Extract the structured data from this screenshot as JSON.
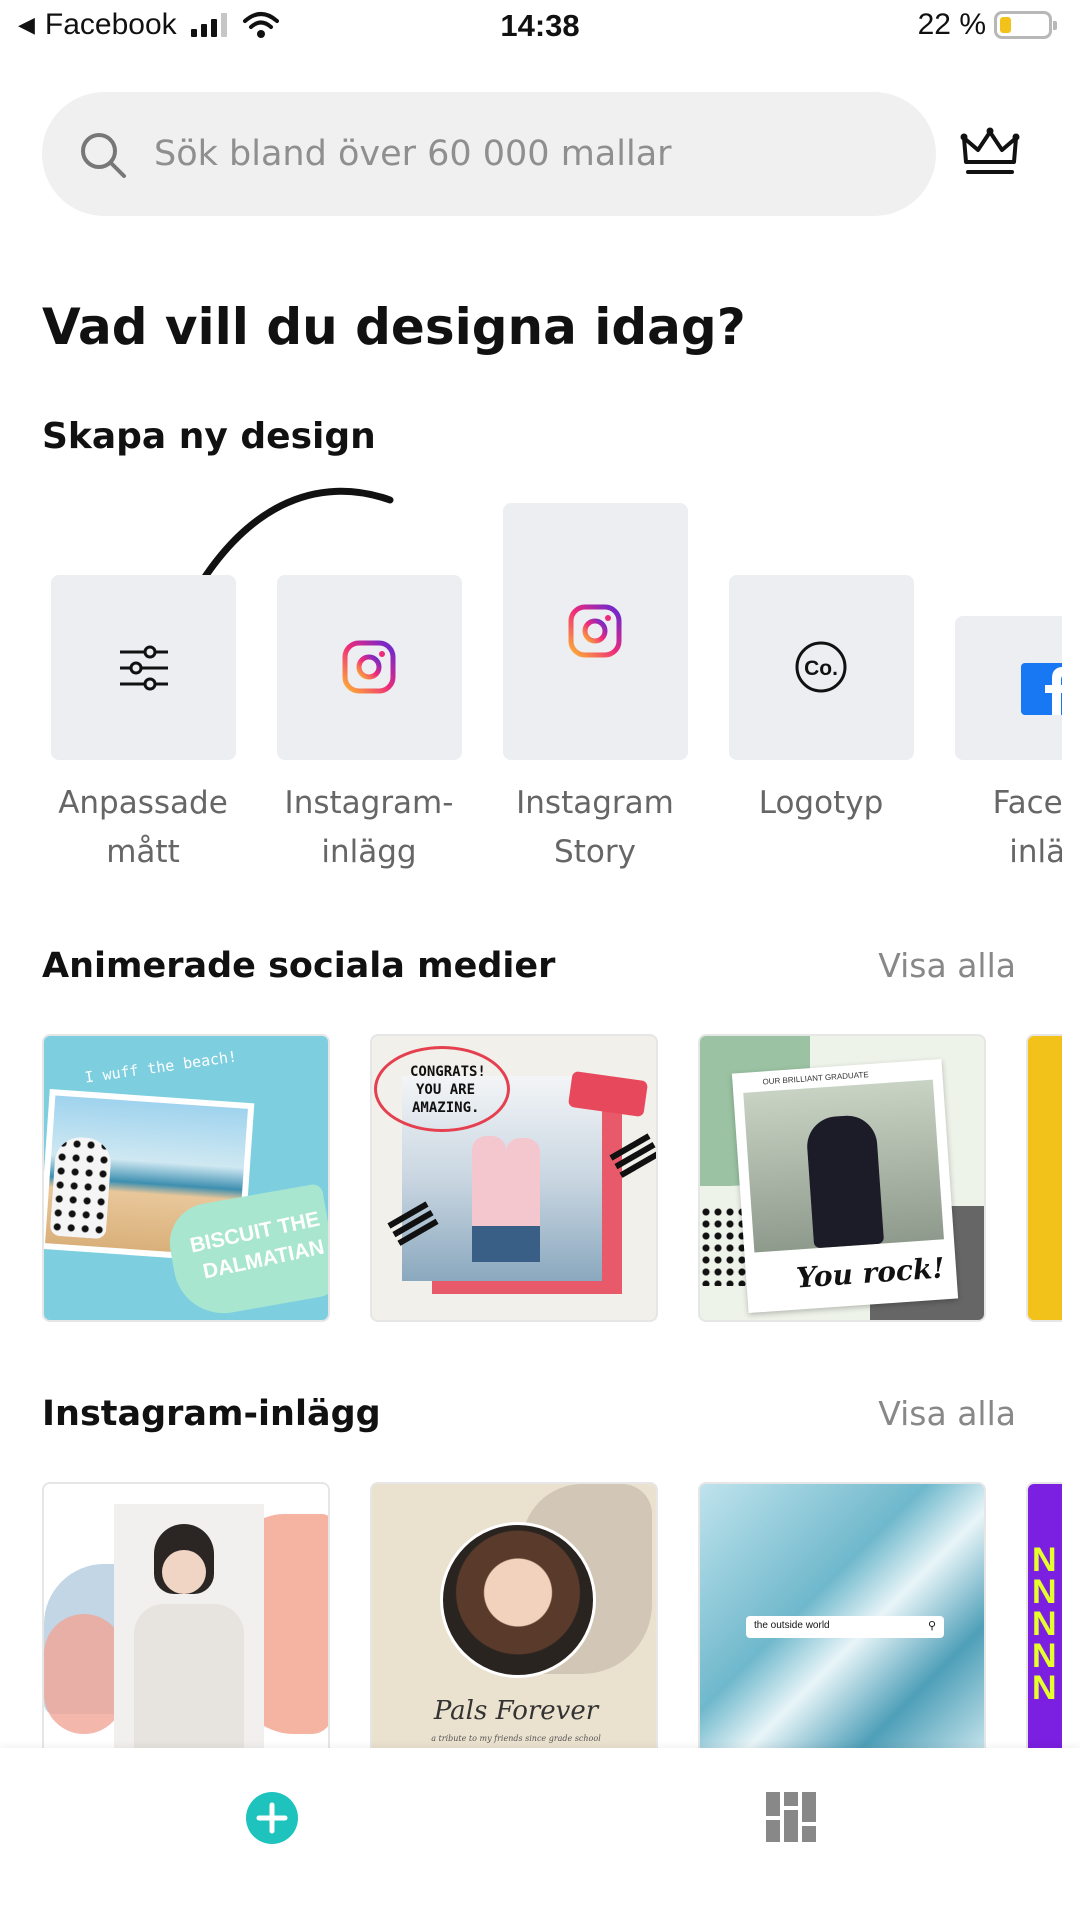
{
  "status_bar": {
    "back_app": "Facebook",
    "time": "14:38",
    "battery": "22 %"
  },
  "search": {
    "placeholder": "Sök bland över 60 000 mallar"
  },
  "headline": "Vad vill du designa idag?",
  "create_section": {
    "title": "Skapa ny design",
    "items": [
      {
        "label_line1": "Anpassade",
        "label_line2": "mått",
        "icon": "sliders-icon"
      },
      {
        "label_line1": "Instagram-",
        "label_line2": "inlägg",
        "icon": "instagram-icon"
      },
      {
        "label_line1": "Instagram",
        "label_line2": "Story",
        "icon": "instagram-icon"
      },
      {
        "label_line1": "Logotyp",
        "label_line2": "",
        "icon": "logo-co-icon"
      },
      {
        "label_line1": "Facebo",
        "label_line2": "inläg",
        "icon": "facebook-icon"
      }
    ]
  },
  "animated_section": {
    "title": "Animerade sociala medier",
    "see_all": "Visa alla",
    "templates": [
      {
        "text1": "I wuff the beach!",
        "text2": "BISCUIT THE",
        "text3": "DALMATIAN"
      },
      {
        "text1": "CONGRATS!",
        "text2": "YOU ARE",
        "text3": "AMAZING."
      },
      {
        "text1": "OUR BRILLIANT GRADUATE",
        "text2": "You rock!"
      }
    ]
  },
  "instagram_section": {
    "title": "Instagram-inlägg",
    "see_all": "Visa alla",
    "templates": [
      {
        "text1": ""
      },
      {
        "text1": "Pals Forever",
        "text2": "a tribute to my friends since grade school"
      },
      {
        "text1": "the outside world"
      }
    ]
  },
  "colors": {
    "accent_teal": "#1fc3be",
    "tile_bg": "#eceef1",
    "muted_text": "#888888"
  }
}
